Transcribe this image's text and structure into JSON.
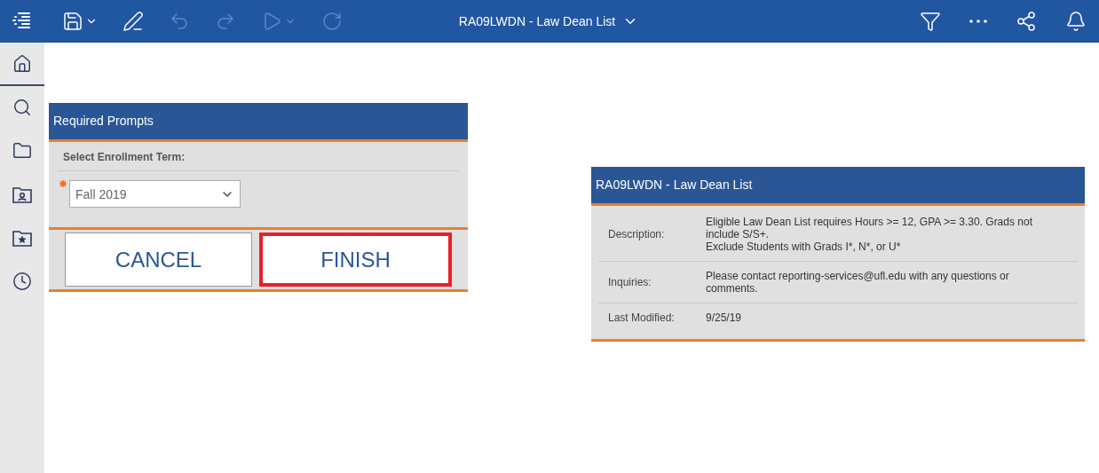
{
  "toolbar": {
    "left": [
      {
        "kind": "menu",
        "disabled": false
      },
      {
        "kind": "save",
        "disabled": false,
        "caret": true
      },
      {
        "kind": "edit",
        "disabled": false
      },
      {
        "kind": "undo",
        "disabled": true
      },
      {
        "kind": "redo",
        "disabled": true
      },
      {
        "kind": "run",
        "disabled": true,
        "caret": true
      },
      {
        "kind": "refresh",
        "disabled": true
      }
    ],
    "title": "RA09LWDN - Law Dean List",
    "right": [
      {
        "kind": "filter"
      },
      {
        "kind": "more"
      },
      {
        "kind": "share"
      },
      {
        "kind": "notifications"
      }
    ]
  },
  "sidebar": {
    "items": [
      {
        "kind": "home",
        "selected": true
      },
      {
        "kind": "search",
        "selected": false
      },
      {
        "kind": "folder",
        "selected": false
      },
      {
        "kind": "team-folder",
        "selected": false
      },
      {
        "kind": "favorites",
        "selected": false
      },
      {
        "kind": "recent",
        "selected": false
      }
    ]
  },
  "prompt_panel": {
    "title": "Required Prompts",
    "label": "Select Enrollment Term:",
    "required": true,
    "value": "Fall 2019",
    "buttons": [
      {
        "label": "CANCEL",
        "highlighted": false
      },
      {
        "label": "FINISH",
        "highlighted": true
      }
    ]
  },
  "info_panel": {
    "title": "RA09LWDN - Law Dean List",
    "rows": [
      {
        "label": "Description:",
        "lines": [
          "Eligible Law Dean List requires Hours >= 12, GPA >= 3.30. Grads not include S/S+.",
          "Exclude Students with Grads I*, N*, or U*"
        ]
      },
      {
        "label": "Inquiries:",
        "lines": [
          "Please contact reporting-services@ufl.edu with any questions or comments."
        ]
      },
      {
        "label": "Last Modified:",
        "lines": [
          "9/25/19"
        ]
      }
    ]
  }
}
